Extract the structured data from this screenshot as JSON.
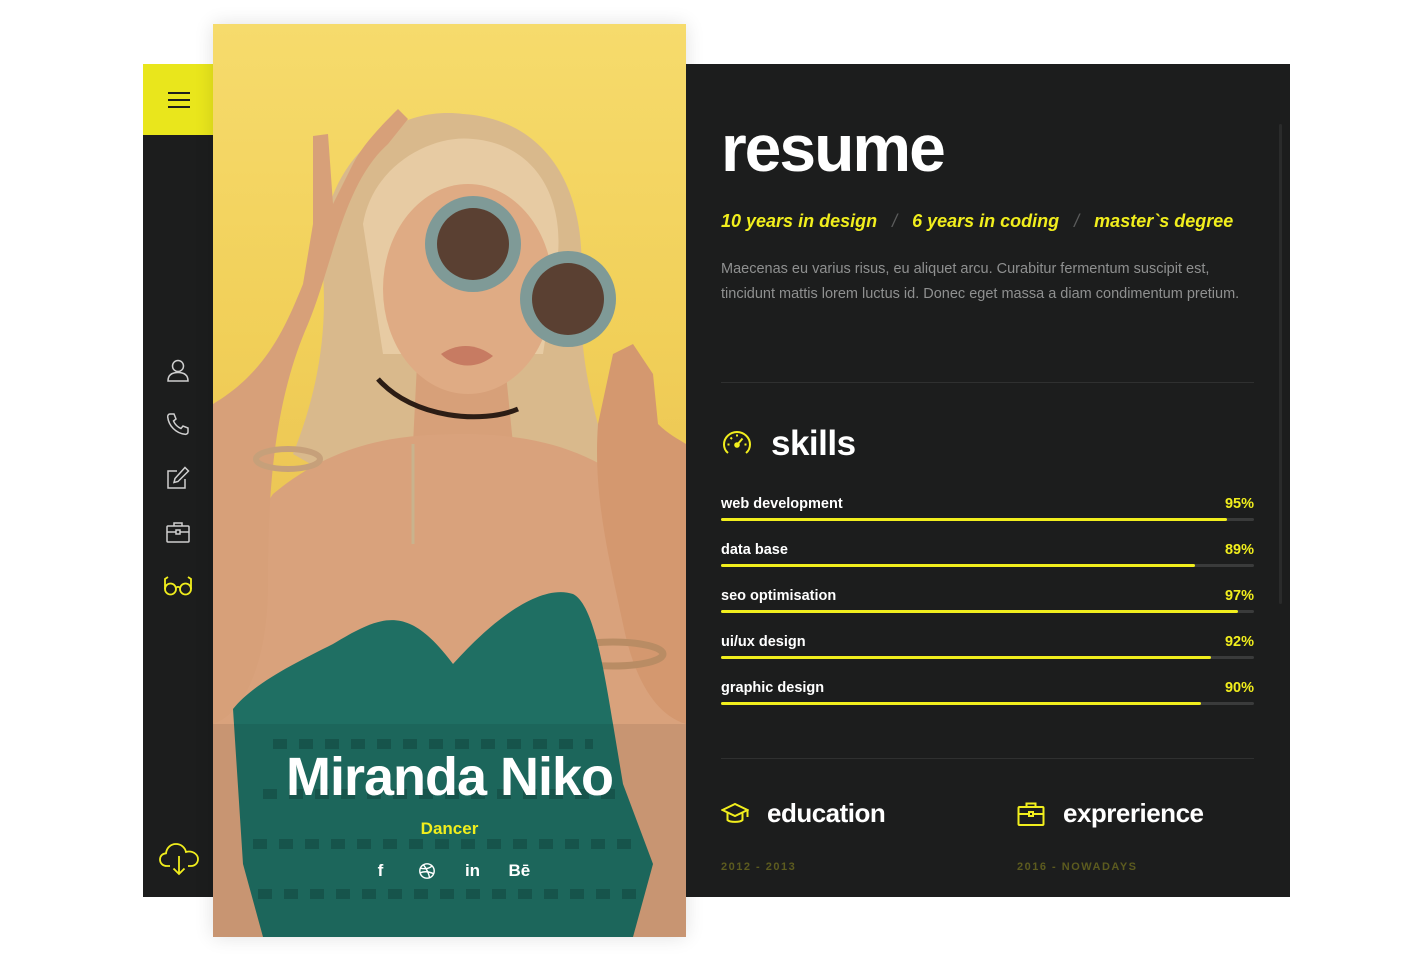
{
  "sidebar": {
    "menu_icon": "hamburger-menu-icon",
    "items": [
      {
        "icon": "user-icon",
        "active": false
      },
      {
        "icon": "phone-icon",
        "active": false
      },
      {
        "icon": "edit-icon",
        "active": false
      },
      {
        "icon": "briefcase-icon",
        "active": false
      },
      {
        "icon": "glasses-icon",
        "active": true
      }
    ],
    "download_icon": "cloud-download-icon"
  },
  "profile": {
    "name": "Miranda Niko",
    "role": "Dancer",
    "socials": [
      {
        "icon": "facebook-icon",
        "label": "f"
      },
      {
        "icon": "dribbble-icon",
        "label": ""
      },
      {
        "icon": "linkedin-icon",
        "label": "in"
      },
      {
        "icon": "behance-icon",
        "label": "Bē"
      }
    ]
  },
  "resume": {
    "title": "resume",
    "highlights": [
      "10 years in design",
      "6 years in coding",
      "master`s degree"
    ],
    "separator": "/",
    "intro": "Maecenas eu varius risus, eu aliquet arcu. Curabitur fermentum suscipit est, tincidunt mattis lorem luctus id. Donec eget massa a diam condimentum pretium."
  },
  "skills": {
    "title": "skills",
    "icon": "speedometer-icon",
    "items": [
      {
        "name": "web development",
        "percent_label": "95%",
        "value": 0.95
      },
      {
        "name": "data base",
        "percent_label": "89%",
        "value": 0.89
      },
      {
        "name": "seo optimisation",
        "percent_label": "97%",
        "value": 0.97
      },
      {
        "name": "ui/ux design",
        "percent_label": "92%",
        "value": 0.92
      },
      {
        "name": "graphic design",
        "percent_label": "90%",
        "value": 0.9
      }
    ]
  },
  "education": {
    "title": "education",
    "icon": "graduation-cap-icon",
    "period": "2012 - 2013"
  },
  "experience": {
    "title": "exprerience",
    "icon": "briefcase-icon",
    "period": "2016 - NOWADAYS"
  },
  "colors": {
    "accent": "#f1ee1d",
    "panel": "#1c1d1d",
    "menu_button": "#e9e61c",
    "photo_background": "#f1cf58"
  }
}
